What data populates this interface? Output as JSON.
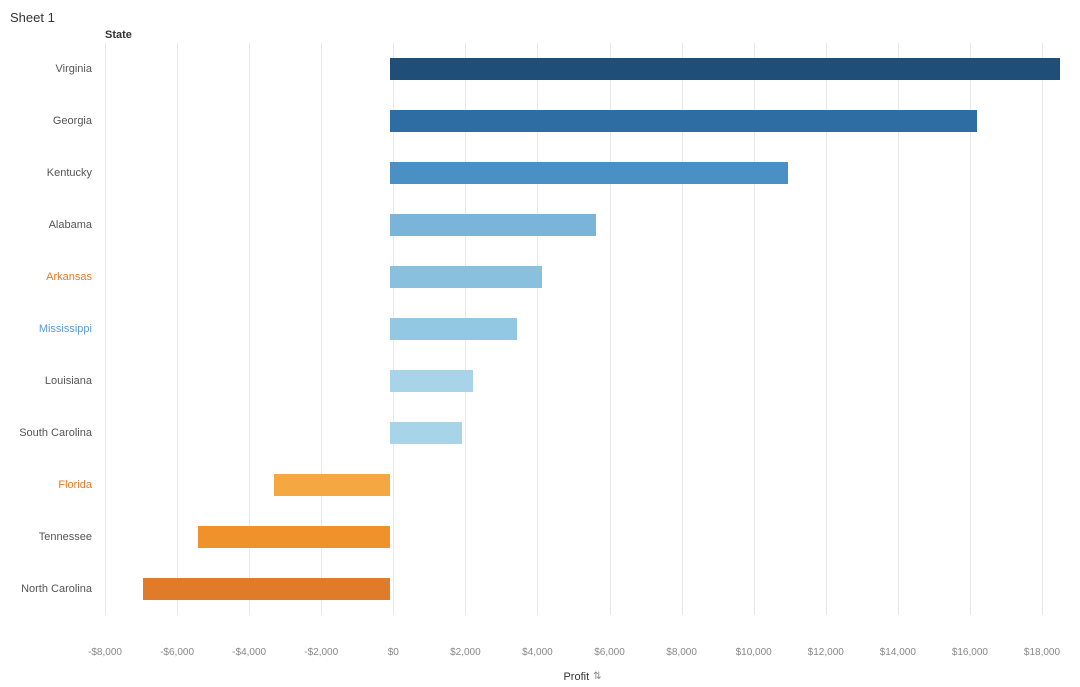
{
  "title": "Sheet 1",
  "col_header": "State",
  "axis_label": "Profit",
  "chart": {
    "zero_pct": 42.5,
    "width_per_1000": 2.35,
    "x_ticks": [
      {
        "label": "-$8,000",
        "value": -8000
      },
      {
        "label": "-$6,000",
        "value": -6000
      },
      {
        "label": "-$4,000",
        "value": -4000
      },
      {
        "label": "-$2,000",
        "value": -2000
      },
      {
        "label": "$0",
        "value": 0
      },
      {
        "label": "$2,000",
        "value": 2000
      },
      {
        "label": "$4,000",
        "value": 4000
      },
      {
        "label": "$6,000",
        "value": 6000
      },
      {
        "label": "$8,000",
        "value": 8000
      },
      {
        "label": "$10,000",
        "value": 10000
      },
      {
        "label": "$12,000",
        "value": 12000
      },
      {
        "label": "$14,000",
        "value": 14000
      },
      {
        "label": "$16,000",
        "value": 16000
      },
      {
        "label": "$18,000",
        "value": 18000
      }
    ],
    "bars": [
      {
        "state": "Virginia",
        "value": 18500,
        "color": "#1f4e79",
        "label_class": ""
      },
      {
        "state": "Georgia",
        "value": 16200,
        "color": "#2e6da4",
        "label_class": ""
      },
      {
        "state": "Kentucky",
        "value": 11000,
        "color": "#4a90c4",
        "label_class": ""
      },
      {
        "state": "Alabama",
        "value": 5700,
        "color": "#7ab5d9",
        "label_class": ""
      },
      {
        "state": "Arkansas",
        "value": 4200,
        "color": "#89c0de",
        "label_class": "orange"
      },
      {
        "state": "Mississippi",
        "value": 3500,
        "color": "#93c8e3",
        "label_class": "blue-light"
      },
      {
        "state": "Louisiana",
        "value": 2300,
        "color": "#a8d4ea",
        "label_class": ""
      },
      {
        "state": "South Carolina",
        "value": 2000,
        "color": "#a8d4ea",
        "label_class": ""
      },
      {
        "state": "Florida",
        "value": -3200,
        "color": "#f5a742",
        "label_class": "orange"
      },
      {
        "state": "Tennessee",
        "value": -5300,
        "color": "#f0922b",
        "label_class": ""
      },
      {
        "state": "North Carolina",
        "value": -6800,
        "color": "#e07b2a",
        "label_class": ""
      }
    ]
  }
}
